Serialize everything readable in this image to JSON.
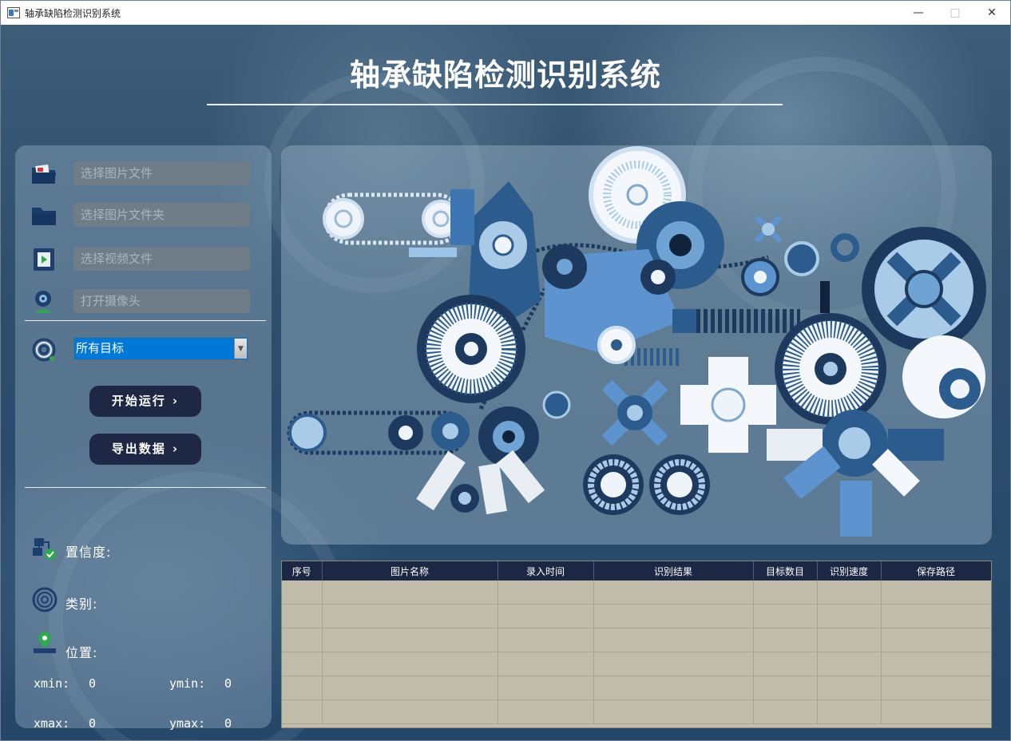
{
  "window": {
    "title": "轴承缺陷检测识别系统"
  },
  "header": {
    "title": "轴承缺陷检测识别系统"
  },
  "inputs": {
    "image_file": "选择图片文件",
    "image_folder": "选择图片文件夹",
    "video_file": "选择视频文件",
    "camera": "打开摄像头"
  },
  "target_select": {
    "selected": "所有目标"
  },
  "buttons": {
    "start": "开始运行",
    "export": "导出数据"
  },
  "info": {
    "confidence_label": "置信度:",
    "class_label": "类别:",
    "position_label": "位置:",
    "xmin_label": "xmin:",
    "xmin_value": "0",
    "ymin_label": "ymin:",
    "ymin_value": "0",
    "xmax_label": "xmax:",
    "xmax_value": "0",
    "ymax_label": "ymax:",
    "ymax_value": "0"
  },
  "table": {
    "headers": [
      "序号",
      "图片名称",
      "录入时间",
      "识别结果",
      "目标数目",
      "识别速度",
      "保存路径"
    ],
    "row_count": 6
  },
  "colors": {
    "accent": "#0078d7",
    "button": "#1e2744",
    "table_bg": "#c2bdab",
    "header_bg": "#1c2744"
  }
}
